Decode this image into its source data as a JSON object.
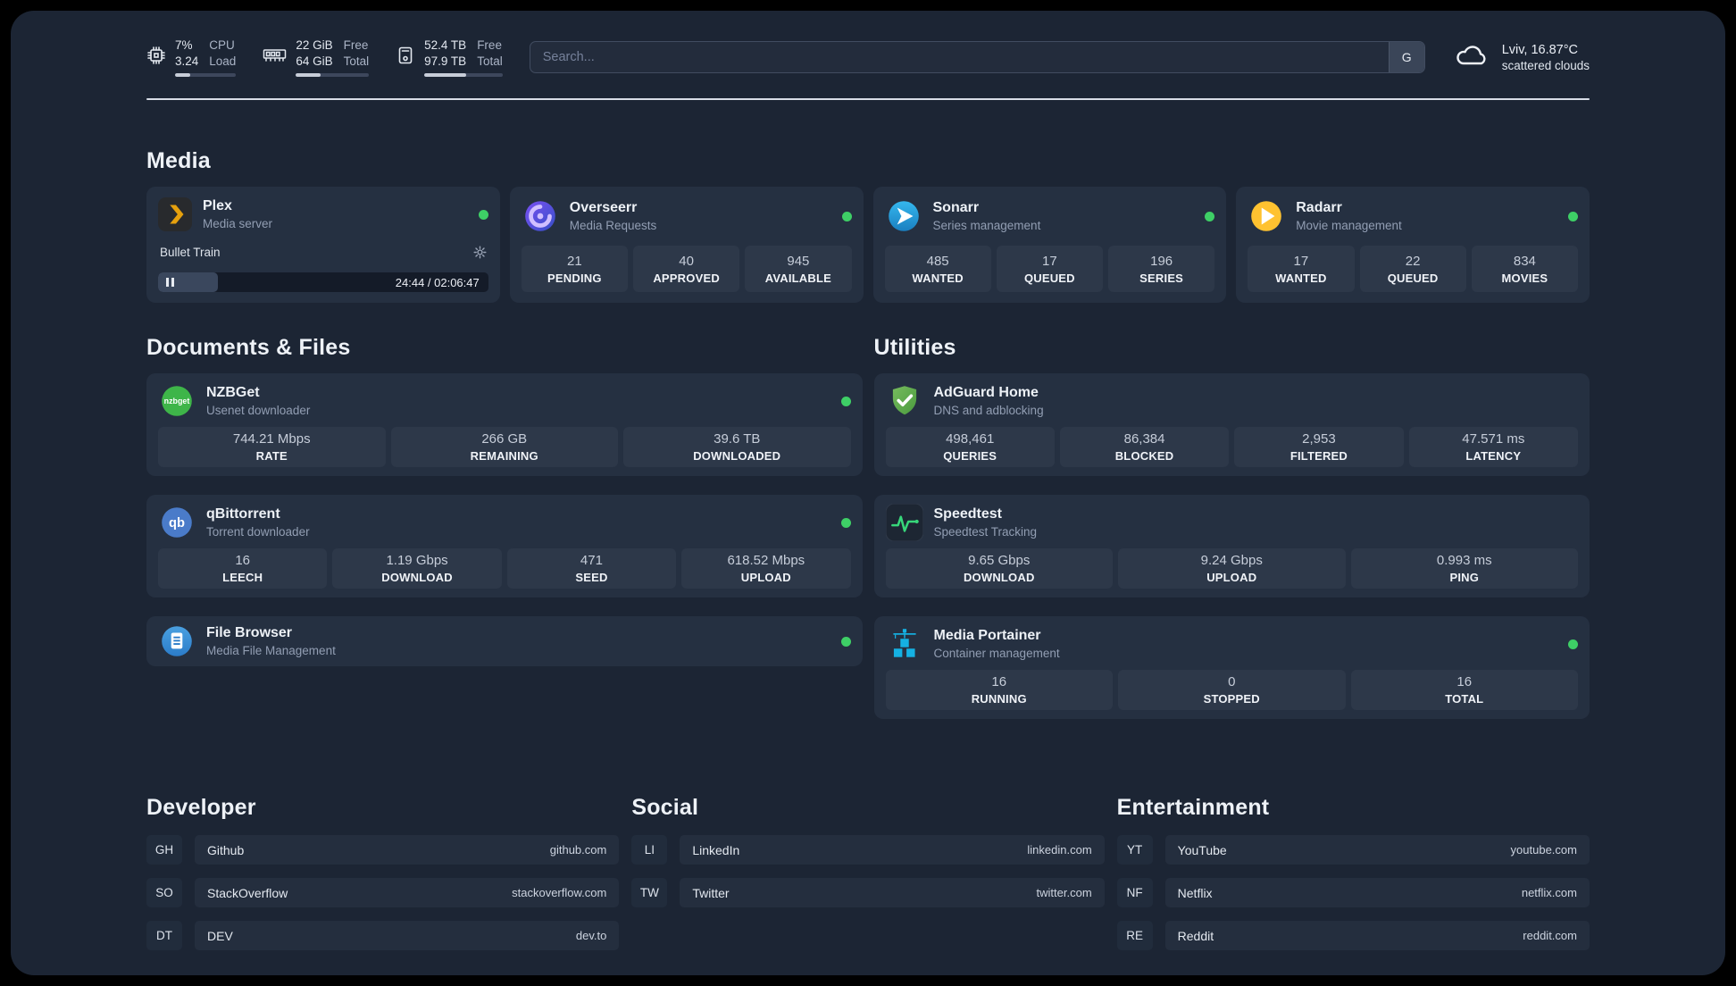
{
  "colors": {
    "status_online": "#3ecf66",
    "background": "#1c2534",
    "card": "#253041",
    "plex_accent": "#e5a00d",
    "radarr_accent": "#ffc230",
    "sonarr_accent": "#2fa7dd",
    "overseerr_accent": "#7950f2",
    "nzbget_accent": "#3eb549",
    "qbittorrent_accent": "#4a7bc9",
    "adguard_accent": "#5aa94a",
    "speedtest_accent": "#37d67a",
    "portainer_accent": "#15b1e3"
  },
  "header": {
    "cpu": {
      "icon": "cpu-chip-icon",
      "value_top": "7%",
      "value_bottom": "3.24",
      "label_top": "CPU",
      "label_bottom": "Load",
      "progress_percent": 25
    },
    "ram": {
      "icon": "memory-icon",
      "value_top": "22 GiB",
      "value_bottom": "64 GiB",
      "label_top": "Free",
      "label_bottom": "Total",
      "progress_percent": 34
    },
    "disk": {
      "icon": "disk-icon",
      "value_top": "52.4 TB",
      "value_bottom": "97.9 TB",
      "label_top": "Free",
      "label_bottom": "Total",
      "progress_percent": 53
    },
    "search": {
      "placeholder": "Search...",
      "engine_button": "G"
    },
    "weather": {
      "icon": "cloud-icon",
      "location": "Lviv, 16.87°C",
      "condition": "scattered clouds"
    }
  },
  "media": {
    "title": "Media",
    "plex": {
      "name": "Plex",
      "subtitle": "Media server",
      "status": "online",
      "now_playing": {
        "title": "Bullet Train",
        "time": "24:44 / 02:06:47",
        "progress_percent": 18
      }
    },
    "overseerr": {
      "name": "Overseerr",
      "subtitle": "Media Requests",
      "status": "online",
      "stats": [
        {
          "value": "21",
          "label": "PENDING"
        },
        {
          "value": "40",
          "label": "APPROVED"
        },
        {
          "value": "945",
          "label": "AVAILABLE"
        }
      ]
    },
    "sonarr": {
      "name": "Sonarr",
      "subtitle": "Series management",
      "status": "online",
      "stats": [
        {
          "value": "485",
          "label": "WANTED"
        },
        {
          "value": "17",
          "label": "QUEUED"
        },
        {
          "value": "196",
          "label": "SERIES"
        }
      ]
    },
    "radarr": {
      "name": "Radarr",
      "subtitle": "Movie management",
      "status": "online",
      "stats": [
        {
          "value": "17",
          "label": "WANTED"
        },
        {
          "value": "22",
          "label": "QUEUED"
        },
        {
          "value": "834",
          "label": "MOVIES"
        }
      ]
    }
  },
  "documents": {
    "title": "Documents & Files",
    "nzbget": {
      "name": "NZBGet",
      "subtitle": "Usenet downloader",
      "status": "online",
      "stats": [
        {
          "value": "744.21 Mbps",
          "label": "RATE"
        },
        {
          "value": "266 GB",
          "label": "REMAINING"
        },
        {
          "value": "39.6 TB",
          "label": "DOWNLOADED"
        }
      ]
    },
    "qbittorrent": {
      "name": "qBittorrent",
      "subtitle": "Torrent downloader",
      "status": "online",
      "stats": [
        {
          "value": "16",
          "label": "LEECH"
        },
        {
          "value": "1.19 Gbps",
          "label": "DOWNLOAD"
        },
        {
          "value": "471",
          "label": "SEED"
        },
        {
          "value": "618.52 Mbps",
          "label": "UPLOAD"
        }
      ]
    },
    "filebrowser": {
      "name": "File Browser",
      "subtitle": "Media File Management",
      "status": "online"
    }
  },
  "utilities": {
    "title": "Utilities",
    "adguard": {
      "name": "AdGuard Home",
      "subtitle": "DNS and adblocking",
      "stats": [
        {
          "value": "498,461",
          "label": "QUERIES"
        },
        {
          "value": "86,384",
          "label": "BLOCKED"
        },
        {
          "value": "2,953",
          "label": "FILTERED"
        },
        {
          "value": "47.571 ms",
          "label": "LATENCY"
        }
      ]
    },
    "speedtest": {
      "name": "Speedtest",
      "subtitle": "Speedtest Tracking",
      "stats": [
        {
          "value": "9.65 Gbps",
          "label": "DOWNLOAD"
        },
        {
          "value": "9.24 Gbps",
          "label": "UPLOAD"
        },
        {
          "value": "0.993 ms",
          "label": "PING"
        }
      ]
    },
    "portainer": {
      "name": "Media Portainer",
      "subtitle": "Container management",
      "status": "online",
      "stats": [
        {
          "value": "16",
          "label": "RUNNING"
        },
        {
          "value": "0",
          "label": "STOPPED"
        },
        {
          "value": "16",
          "label": "TOTAL"
        }
      ]
    }
  },
  "bookmarks": {
    "developer": {
      "title": "Developer",
      "items": [
        {
          "abbr": "GH",
          "name": "Github",
          "url": "github.com"
        },
        {
          "abbr": "SO",
          "name": "StackOverflow",
          "url": "stackoverflow.com"
        },
        {
          "abbr": "DT",
          "name": "DEV",
          "url": "dev.to"
        }
      ]
    },
    "social": {
      "title": "Social",
      "items": [
        {
          "abbr": "LI",
          "name": "LinkedIn",
          "url": "linkedin.com"
        },
        {
          "abbr": "TW",
          "name": "Twitter",
          "url": "twitter.com"
        }
      ]
    },
    "entertainment": {
      "title": "Entertainment",
      "items": [
        {
          "abbr": "YT",
          "name": "YouTube",
          "url": "youtube.com"
        },
        {
          "abbr": "NF",
          "name": "Netflix",
          "url": "netflix.com"
        },
        {
          "abbr": "RE",
          "name": "Reddit",
          "url": "reddit.com"
        }
      ]
    }
  }
}
